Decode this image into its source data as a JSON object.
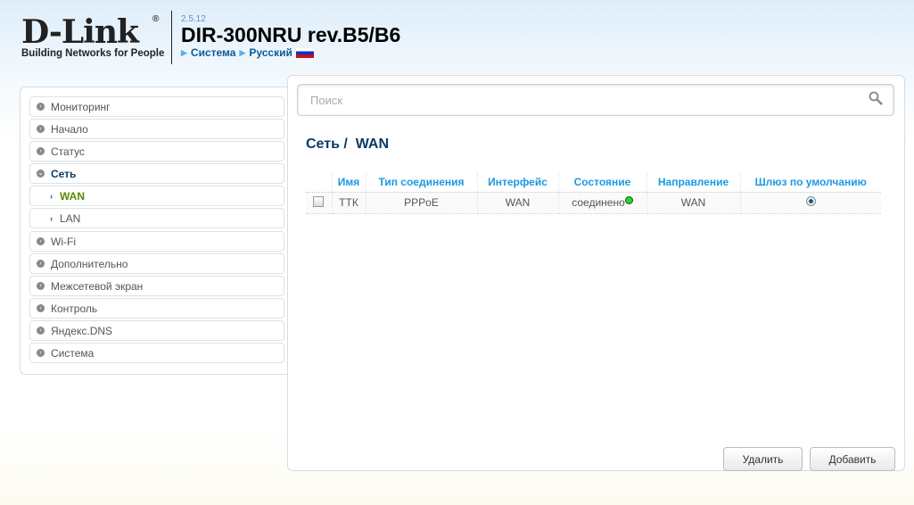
{
  "header": {
    "logo_text": "D-Link",
    "logo_tagline": "Building Networks for People",
    "firmware_version": "2.5.12",
    "model": "DIR-300NRU rev.B5/B6",
    "breadcrumb_system": "Система",
    "breadcrumb_language": "Русский"
  },
  "sidebar": {
    "items": [
      {
        "label": "Мониторинг"
      },
      {
        "label": "Начало"
      },
      {
        "label": "Статус"
      },
      {
        "label": "Сеть"
      },
      {
        "label": "WAN"
      },
      {
        "label": "LAN"
      },
      {
        "label": "Wi-Fi"
      },
      {
        "label": "Дополнительно"
      },
      {
        "label": "Межсетевой экран"
      },
      {
        "label": "Контроль"
      },
      {
        "label": "Яндекс.DNS"
      },
      {
        "label": "Система"
      }
    ]
  },
  "search": {
    "placeholder": "Поиск"
  },
  "main": {
    "title": "Сеть /  WAN",
    "columns": [
      "Имя",
      "Тип соединения",
      "Интерфейс",
      "Состояние",
      "Направление",
      "Шлюз по умолчанию"
    ],
    "rows": [
      {
        "name": "ТТК",
        "type": "PPPoE",
        "interface": "WAN",
        "status": "соединено",
        "direction": "WAN"
      }
    ],
    "delete_label": "Удалить",
    "add_label": "Добавить"
  },
  "colors": {
    "accent": "#1a9ae0",
    "title": "#0b3a66",
    "active": "#5a8a00"
  }
}
